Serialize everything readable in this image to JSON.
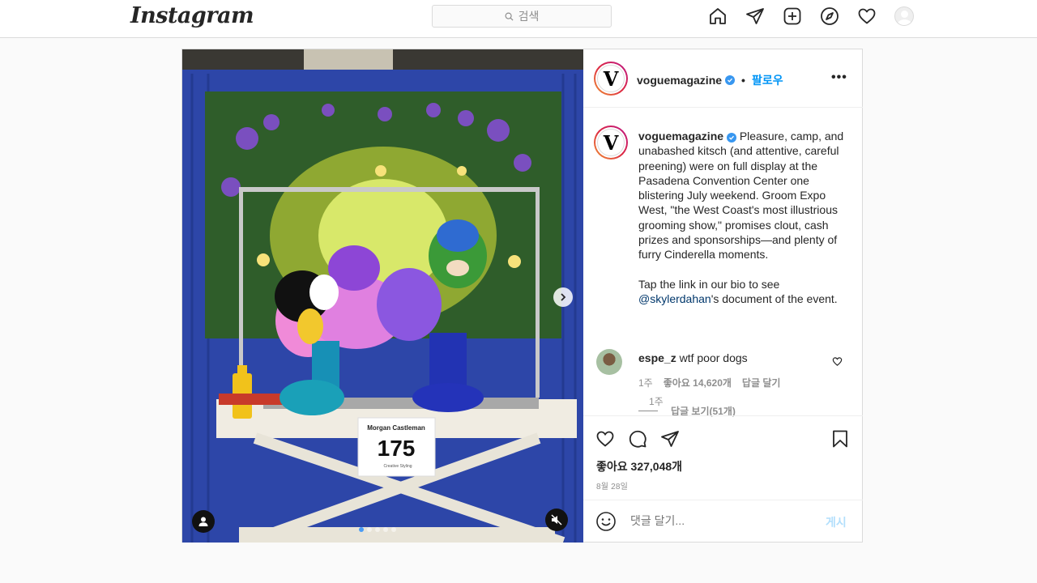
{
  "nav": {
    "logo": "Instagram",
    "search_placeholder": "검색",
    "icons": [
      "home-icon",
      "direct-icon",
      "new-post-icon",
      "explore-icon",
      "activity-icon",
      "profile-avatar"
    ]
  },
  "post": {
    "author": "voguemagazine",
    "separator": "•",
    "follow_label": "팔로우",
    "more_label": "•••",
    "avatar_letter": "V",
    "media_labels": {
      "name_card": "Morgan Castleman",
      "number": "175",
      "category": "Creative Styling"
    },
    "caption": {
      "author": "voguemagazine",
      "text_part1": "Pleasure, camp, and unabashed kitsch (and attentive, careful preening) were on full display at the Pasadena Convention Center one blistering July weekend. Groom Expo West, \"the West Coast's most illustrious grooming show,\" promises clout, cash prizes and sponsorships—and plenty of furry Cinderella moments.",
      "text_part2_prefix": "Tap the link in our bio to see ",
      "mention": "@skylerdahan",
      "text_part2_suffix": "'s document of the event.",
      "time": "1주"
    },
    "comments": [
      {
        "author": "espe_z",
        "text": "wtf poor dogs",
        "time": "1주",
        "likes": "좋아요 14,620개",
        "reply_label": "답글 달기",
        "view_replies": "답글 보기(51개)"
      }
    ],
    "likes": "좋아요 327,048개",
    "date": "8월 28일",
    "comment_placeholder": "댓글 달기...",
    "post_button": "게시"
  }
}
